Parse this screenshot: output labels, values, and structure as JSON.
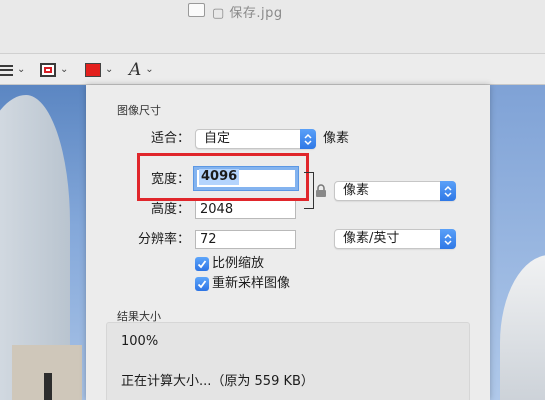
{
  "window": {
    "title": "▢ 保存.jpg"
  },
  "toolbar": {
    "chevron": "⌄"
  },
  "dialog": {
    "image_size_section": "图像尺寸",
    "fit": {
      "label": "适合：",
      "value": "自定",
      "unit": "像素"
    },
    "width": {
      "label": "宽度：",
      "value": "4096"
    },
    "height": {
      "label": "高度：",
      "value": "2048"
    },
    "dimension_unit": "像素",
    "resolution": {
      "label": "分辨率：",
      "value": "72",
      "unit": "像素/英寸"
    },
    "checkboxes": [
      {
        "label": "比例缩放",
        "checked": true
      },
      {
        "label": "重新采样图像",
        "checked": true
      }
    ],
    "result_section": "结果大小",
    "result_percent": "100%",
    "result_status": "正在计算大小...（原为 559 KB）"
  },
  "colors": {
    "accent": "#2f78e6",
    "highlight_border": "#e0262b",
    "fill_color": "#e3201d"
  }
}
